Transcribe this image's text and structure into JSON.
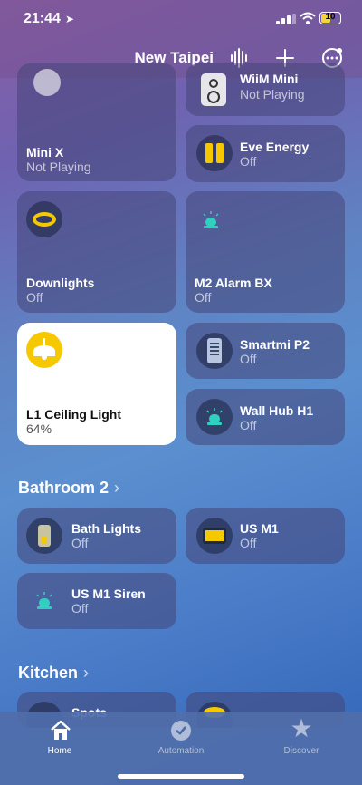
{
  "status": {
    "time": "21:44",
    "battery": "10"
  },
  "header": {
    "title": "New Taipei"
  },
  "tiles": [
    {
      "name": "Mini X",
      "state": "Not Playing"
    },
    {
      "name": "WiiM Mini",
      "state": "Not Playing"
    },
    {
      "name": "Eve Energy",
      "state": "Off"
    },
    {
      "name": "Downlights",
      "state": "Off"
    },
    {
      "name": "M2 Alarm BX",
      "state": "Off"
    },
    {
      "name": "L1 Ceiling Light",
      "state": "64%"
    },
    {
      "name": "Smartmi P2",
      "state": "Off"
    },
    {
      "name": "Wall Hub H1",
      "state": "Off"
    }
  ],
  "bathroom": {
    "title": "Bathroom 2",
    "tiles": [
      {
        "name": "Bath Lights",
        "state": "Off"
      },
      {
        "name": "US M1",
        "state": "Off"
      },
      {
        "name": "US M1 Siren",
        "state": "Off"
      }
    ]
  },
  "kitchen": {
    "title": "Kitchen",
    "tiles": [
      {
        "name": "Spots"
      }
    ]
  },
  "tabs": [
    {
      "label": "Home"
    },
    {
      "label": "Automation"
    },
    {
      "label": "Discover"
    }
  ],
  "colors": {
    "accent": "#f5c800",
    "teal": "#2fd0c0"
  }
}
